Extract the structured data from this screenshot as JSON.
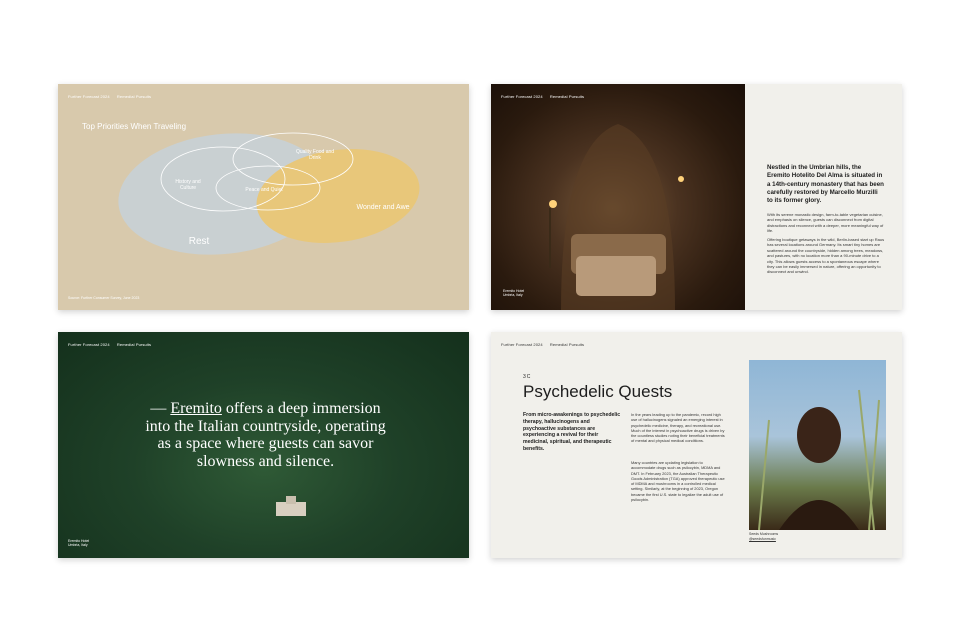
{
  "header": {
    "brand": "Further Forecast 2024",
    "section": "Remedial Pursuits"
  },
  "slide1": {
    "title": "Top Priorities When Traveling",
    "labels": {
      "history": "History and Culture",
      "food": "Quality Food and Drink",
      "peace": "Peace and Quiet",
      "wonder": "Wonder and Awe",
      "rest": "Rest"
    },
    "footnote": "Source: Further Consumer Survey, June 2023",
    "colors": {
      "rest": "#c9d0d2",
      "wonder": "#e8c77a",
      "outline": "#ffffff",
      "bg": "#d8c9ac"
    }
  },
  "slide2": {
    "caption_line1": "Eremito Hotel",
    "caption_line2": "Umbria, Italy",
    "lead": "Nestled in the Umbrian hills, the Eremito Hotelito Del Alma is situated in a 14th-century monastery that has been carefully restored by Marcello Murzilli to its former glory.",
    "para1": "With its serene monastic design, farm-to-table vegetarian cuisine, and emphasis on silence, guests can disconnect from digital distractions and reconnect with a deeper, more meaningful way of life.",
    "para2": "Offering boutique getaways in the wild, Berlin-based start up Raus has several locations around Germany. Its smart tiny homes are scattered around the countryside, hidden among trees, meadows, and pastures, with no location more than a 90-minute drive to a city. This allows guests access to a spontaneous escape where they can be easily immersed in nature, offering an opportunity to disconnect and unwind."
  },
  "slide3": {
    "quote_dash": "— ",
    "quote_link": "Eremito",
    "quote_rest": " offers a deep immersion into the Italian countryside, operating as a space where guests can savor slowness and silence.",
    "caption_line1": "Eremito Hotel",
    "caption_line2": "Umbria, Italy"
  },
  "slide4": {
    "section_num": "3C",
    "title": "Psychedelic Quests",
    "intro": "From micro-awakenings to psychedelic therapy, hallucinogens and psychoactive substances are experiencing a revival for their medicinal, spiritual, and therapeutic benefits.",
    "para1": "In the years leading up to the pandemic, record high use of hallucinogens signaled an emerging interest in psychedelic medicine, therapy, and recreational use. Much of the interest in psychoactive drugs is driven by the countless studies noting their beneficial treatments of mental and physical medical conditions.",
    "para2": "Many countries are updating legislation to accommodate drugs such as psilocybin, MDMA and DMT. In February 2023, the Australian Therapeutic Goods Administration (TGA) approved therapeutic use of MDMA and mushrooms in a controlled medical setting. Similarly, at the beginning of 2023, Oregon became the first U.S. state to legalize the adult use of psilocybin.",
    "caption_line1": "Seeds Mushrooms",
    "caption_line2": "@seedsfunmusic"
  }
}
